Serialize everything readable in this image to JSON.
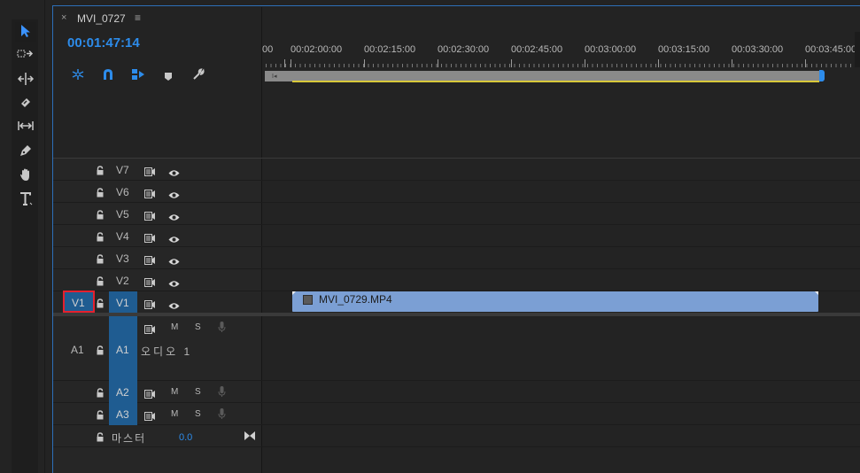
{
  "sequence": {
    "tab_title": "MVI_0727",
    "timecode": "00:01:47:14"
  },
  "ruler": {
    "labels": [
      "00",
      "00:02:00:00",
      "00:02:15:00",
      "00:02:30:00",
      "00:02:45:00",
      "00:03:00:00",
      "00:03:15:00",
      "00:03:30:00",
      "00:03:45:00"
    ]
  },
  "tools": [
    "selection-tool",
    "track-select-forward-tool",
    "ripple-edit-tool",
    "razor-tool",
    "slip-tool",
    "pen-tool",
    "hand-tool",
    "type-tool"
  ],
  "toolbar": [
    "snap-icon",
    "magnet-icon",
    "linked-selection-icon",
    "marker-icon",
    "wrench-icon"
  ],
  "video_tracks": [
    {
      "name": "V7"
    },
    {
      "name": "V6"
    },
    {
      "name": "V5"
    },
    {
      "name": "V4"
    },
    {
      "name": "V3"
    },
    {
      "name": "V2"
    },
    {
      "name": "V1",
      "source": "V1"
    }
  ],
  "audio_tracks": [
    {
      "name": "A1",
      "source": "A1",
      "label": "오디오 1",
      "m": "M",
      "s": "S"
    },
    {
      "name": "A2",
      "m": "M",
      "s": "S"
    },
    {
      "name": "A3",
      "m": "M",
      "s": "S"
    }
  ],
  "master": {
    "label": "마스터",
    "value": "0.0"
  },
  "clip": {
    "name": "MVI_0729.MP4"
  },
  "colors": {
    "accent": "#2d8ceb",
    "clip": "#7b9fd4",
    "track_button": "#1f5c91",
    "highlight": "#e5202e"
  }
}
